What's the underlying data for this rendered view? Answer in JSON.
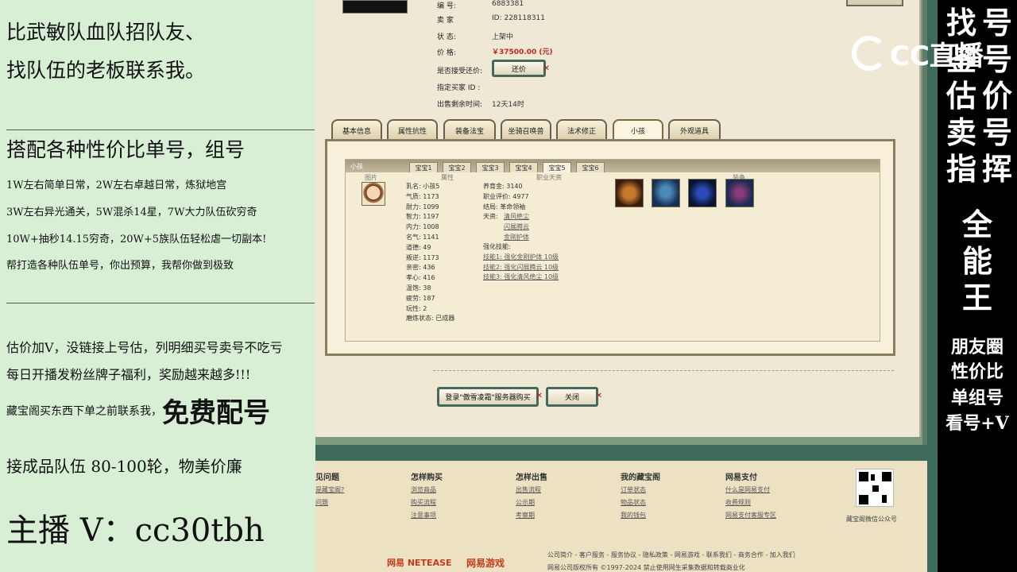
{
  "left": {
    "line1": "比武敏队血队招队友、",
    "line2": "找队伍的老板联系我。",
    "line3": "搭配各种性价比单号，组号",
    "line4": "1W左右简单日常，2W左右卓越日常，炼狱地宫",
    "line5": "3W左右异光通关，5W混杀14星，7W大力队伍砍穷奇",
    "line6": "10W+抽秒14.15穷奇，20W+5族队伍轻松虐一切副本!",
    "line7": "帮打造各种队伍单号，你出预算，我帮你做到极致",
    "line8": "估价加V，没链接上号估，列明细买号卖号不吃亏",
    "line9": "每日开播发粉丝牌子福利，奖励越来越多!!!",
    "line10a": "藏宝阁买东西下单之前联系我，",
    "line10b": "免费配号",
    "line11": "接成品队伍 80-100轮，物美价廉",
    "line12": "主播 V：cc30tbh"
  },
  "right": {
    "col_a": [
      "找",
      "号",
      "估",
      "卖",
      "指",
      "全",
      "能",
      "王"
    ],
    "col_b": [
      "号",
      "号",
      "价",
      "号",
      "挥"
    ],
    "col_a_2": [
      "鉴"
    ],
    "small": [
      "朋友圈",
      "性价比",
      "单组号",
      "看号+V"
    ]
  },
  "logo": {
    "text": "CC直播"
  },
  "item": {
    "labels": {
      "serial": "编       号:",
      "seller": "卖       家",
      "status": "状       态:",
      "price": "价       格:",
      "bargain": "是否接受还价:",
      "buyer": "指定买家 ID :",
      "remain": "出售剩余时间:"
    },
    "values": {
      "serial": "6883381",
      "seller": "ID:  228118311",
      "status": "上架中",
      "price": "￥37500.00 (元)",
      "remain": "12天14时"
    },
    "bargain_button": "还价"
  },
  "tabs": [
    "基本信息",
    "属性抗性",
    "装备法宝",
    "坐骑召唤兽",
    "法术修正",
    "小孩",
    "外观道具"
  ],
  "detail": {
    "header": "小孩",
    "subtabs": [
      "宝宝1",
      "宝宝2",
      "宝宝3",
      "宝宝4",
      "宝宝5",
      "宝宝6"
    ],
    "col_headers": [
      "图片",
      "属性",
      "职业天资",
      "装备"
    ],
    "stats": [
      "乳名: 小孩5",
      "气质: 1173",
      "耐力: 1099",
      "智力: 1197",
      "内力: 1008",
      "名气: 1141",
      "道德: 49",
      "叛逆: 1173",
      "亲密: 436",
      "孝心: 416",
      "温饱: 38",
      "疲劳: 187",
      "玩性: 2",
      "磨炼状态: 已成器"
    ],
    "career": {
      "c1": "养育金: 3140",
      "c2": "职业评价: 4977",
      "c3": "结局: 革命领袖",
      "c4": "天资:",
      "t1": "清风绝尘",
      "t2": "闪展腾云",
      "t3": "金刚护体",
      "s0": "强化技能:",
      "s1": "技能1: 强化金刚护体 10级",
      "s2": "技能2: 强化闪展腾云 10级",
      "s3": "技能3: 强化清风绝尘 10级"
    }
  },
  "actions": {
    "login": "登录\"傲雪凌霜\"服务器购买",
    "close": "关闭"
  },
  "footer": {
    "heads": [
      "见问题",
      "怎样购买",
      "怎样出售",
      "我的藏宝阁",
      "网易支付"
    ],
    "col1": [
      "是藏宝阁?",
      "问题"
    ],
    "col2": [
      "浏览商品",
      "购买流程",
      "注意事项"
    ],
    "col3": [
      "出售流程",
      "公示期",
      "考察期"
    ],
    "col4": [
      "订单状态",
      "物品状态",
      "我的钱包"
    ],
    "col5": [
      "什么是网易支付",
      "收费规则",
      "网易支付客服专区"
    ],
    "qr_caption": "藏宝阁微信公众号",
    "links_line": "公司简介 - 客户服务 - 服务协议 - 隐私政策 - 网易游戏 - 联系我们 - 商务合作 - 加入我们",
    "copyright": "网易公司版权所有 ©1997-2024 禁止使用网生采集数据和转载商业化",
    "brand1": "网易 NETEASE",
    "brand2": "网易游戏"
  }
}
